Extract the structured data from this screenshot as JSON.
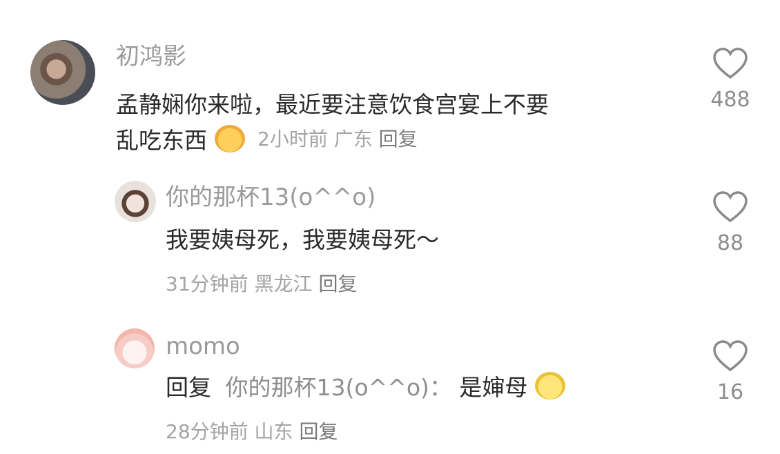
{
  "comments": [
    {
      "author": "初鸿影",
      "text_line1": "孟静娴你来啦，最近要注意饮食宫宴上不要",
      "text_line2": "乱吃东西",
      "emoji": "cat-face-icon",
      "time": "2小时前",
      "location": "广东",
      "reply_label": "回复",
      "likes": "488"
    },
    {
      "author": "你的那杯13(o^^o)",
      "text": "我要姨母死，我要姨母死～",
      "time": "31分钟前",
      "location": "黑龙江",
      "reply_label": "回复",
      "likes": "88"
    },
    {
      "author": "momo",
      "reply_prefix": "回复",
      "reply_target": "你的那杯13(o^^o)：",
      "text": "是婶母",
      "emoji": "lemon-face-icon",
      "time": "28分钟前",
      "location": "山东",
      "reply_label": "回复",
      "likes": "16"
    }
  ]
}
